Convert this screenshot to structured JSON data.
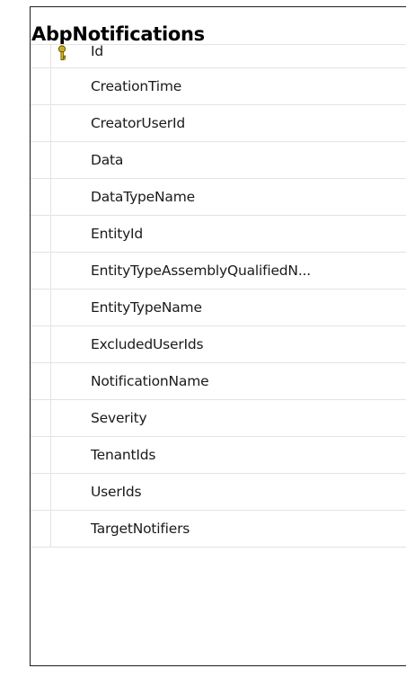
{
  "table": {
    "name": "AbpNotifications",
    "columns": [
      {
        "label": "Id",
        "primary_key": true,
        "icon": "key-icon"
      },
      {
        "label": "CreationTime"
      },
      {
        "label": "CreatorUserId"
      },
      {
        "label": "Data"
      },
      {
        "label": "DataTypeName"
      },
      {
        "label": "EntityId"
      },
      {
        "label": "EntityTypeAssemblyQualifiedN..."
      },
      {
        "label": "EntityTypeName"
      },
      {
        "label": "ExcludedUserIds"
      },
      {
        "label": "NotificationName"
      },
      {
        "label": "Severity"
      },
      {
        "label": "TenantIds"
      },
      {
        "label": "UserIds"
      },
      {
        "label": "TargetNotifiers"
      }
    ]
  },
  "colors": {
    "border": "#1e1e1e",
    "row_divider": "#e3e3e3",
    "key_fill": "#f2c811",
    "key_outline": "#6b5a00",
    "text": "#1a1a1a"
  }
}
